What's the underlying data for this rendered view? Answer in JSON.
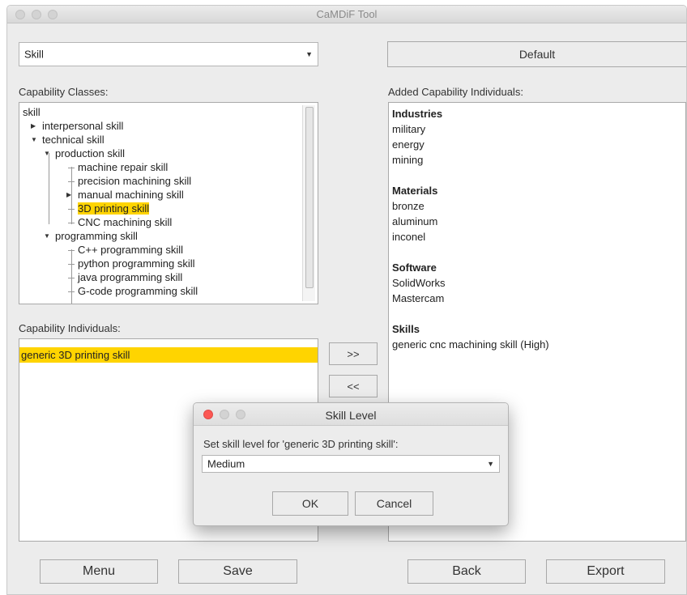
{
  "window": {
    "title": "CaMDiF Tool"
  },
  "top": {
    "class_select_value": "Skill",
    "default_button": "Default"
  },
  "labels": {
    "capability_classes": "Capability Classes:",
    "added_individuals": "Added Capability Individuals:",
    "capability_individuals": "Capability Individuals:"
  },
  "tree": [
    {
      "label": "skill",
      "depth": 0,
      "toggle": "none"
    },
    {
      "label": "interpersonal skill",
      "depth": 1,
      "toggle": "collapsed"
    },
    {
      "label": "technical skill",
      "depth": 1,
      "toggle": "expanded"
    },
    {
      "label": "production skill",
      "depth": 2,
      "toggle": "expanded"
    },
    {
      "label": "machine repair skill",
      "depth": 3,
      "toggle": "leaf"
    },
    {
      "label": "precision machining skill",
      "depth": 3,
      "toggle": "leaf"
    },
    {
      "label": "manual machining skill",
      "depth": 3,
      "toggle": "collapsed"
    },
    {
      "label": "3D printing skill",
      "depth": 3,
      "toggle": "leaf",
      "selected": true
    },
    {
      "label": "CNC machining skill",
      "depth": 3,
      "toggle": "leaf"
    },
    {
      "label": "programming skill",
      "depth": 2,
      "toggle": "expanded"
    },
    {
      "label": "C++ programming skill",
      "depth": 3,
      "toggle": "leaf"
    },
    {
      "label": "python programming skill",
      "depth": 3,
      "toggle": "leaf"
    },
    {
      "label": "java programming skill",
      "depth": 3,
      "toggle": "leaf"
    },
    {
      "label": "G-code programming skill",
      "depth": 3,
      "toggle": "leaf"
    }
  ],
  "individuals": [
    {
      "label": "generic 3D printing skill",
      "selected": true
    }
  ],
  "transfer": {
    "add": ">>",
    "remove": "<<"
  },
  "added": [
    {
      "label": "Industries",
      "head": true
    },
    {
      "label": "military"
    },
    {
      "label": "energy"
    },
    {
      "label": "mining"
    },
    {
      "label": "",
      "spacer": true
    },
    {
      "label": "Materials",
      "head": true
    },
    {
      "label": "bronze"
    },
    {
      "label": "aluminum"
    },
    {
      "label": "inconel"
    },
    {
      "label": "",
      "spacer": true
    },
    {
      "label": "Software",
      "head": true
    },
    {
      "label": "SolidWorks"
    },
    {
      "label": "Mastercam"
    },
    {
      "label": "",
      "spacer": true
    },
    {
      "label": "Skills",
      "head": true
    },
    {
      "label": "generic cnc machining skill (High)"
    }
  ],
  "dialog": {
    "title": "Skill Level",
    "prompt": "Set skill level for 'generic 3D printing skill':",
    "level_value": "Medium",
    "ok": "OK",
    "cancel": "Cancel"
  },
  "bottom": {
    "menu": "Menu",
    "save": "Save",
    "back": "Back",
    "export": "Export"
  },
  "colors": {
    "highlight": "#ffd400",
    "close_red": "#fc5753"
  }
}
